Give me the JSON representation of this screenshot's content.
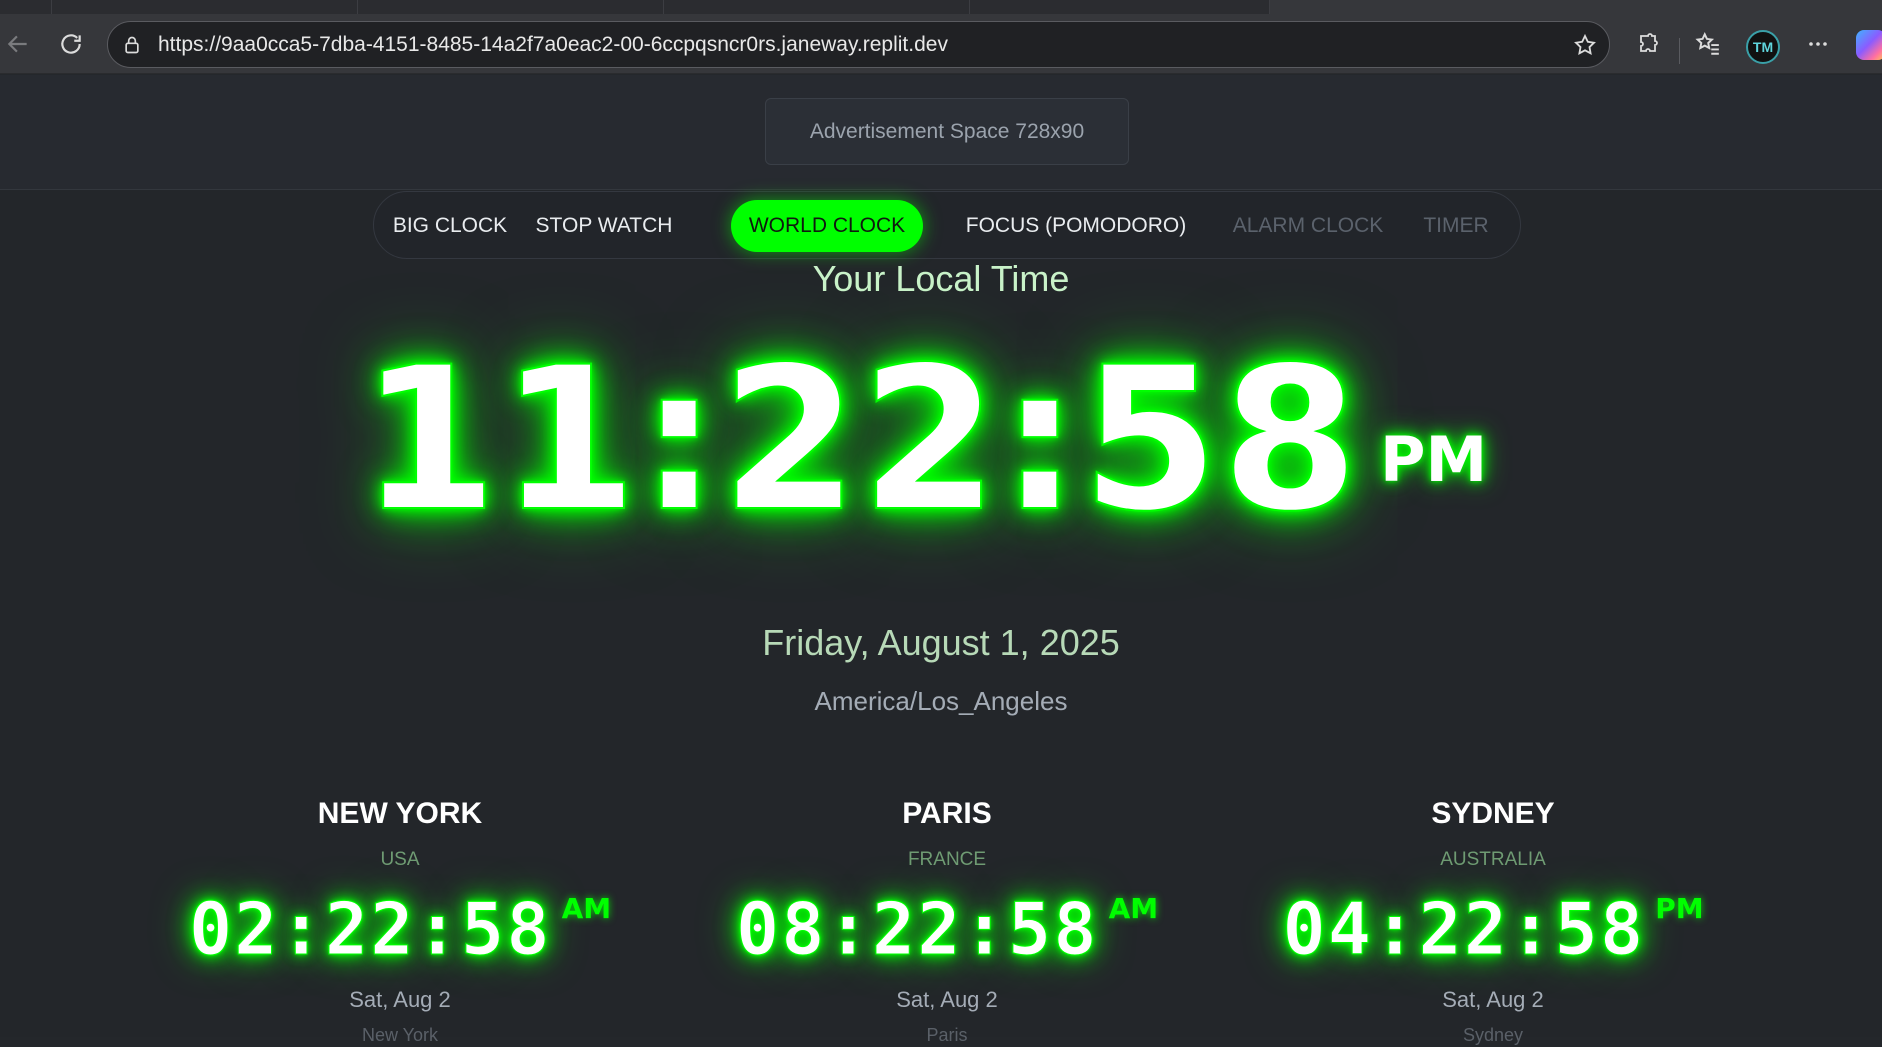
{
  "browser": {
    "url": "https://9aa0cca5-7dba-4151-8485-14a2f7a0eac2-00-6ccpqsncr0rs.janeway.replit.dev",
    "profile_initials": "TM",
    "icons": {
      "back": "back-arrow-icon",
      "reload": "reload-icon",
      "site_info": "lock-icon",
      "favorite": "star-icon",
      "extensions": "puzzle-icon",
      "favorites": "favorites-list-icon",
      "menu": "more-icon",
      "copilot": "copilot-icon"
    }
  },
  "ad": {
    "label": "Advertisement Space 728x90"
  },
  "nav": {
    "items": [
      {
        "label": "BIG CLOCK",
        "state": "normal"
      },
      {
        "label": "STOP WATCH",
        "state": "normal"
      },
      {
        "label": "WORLD CLOCK",
        "state": "active"
      },
      {
        "label": "FOCUS (POMODORO)",
        "state": "normal"
      },
      {
        "label": "ALARM CLOCK",
        "state": "dim"
      },
      {
        "label": "TIMER",
        "state": "dim"
      }
    ]
  },
  "local": {
    "title": "Your Local Time",
    "time": "11:22:58",
    "ampm": "PM",
    "date": "Friday, August 1, 2025",
    "timezone": "America/Los_Angeles"
  },
  "cities": [
    {
      "name": "NEW YORK",
      "country": "USA",
      "time": "02:22:58",
      "ampm": "AM",
      "date": "Sat, Aug 2",
      "sub": "New York"
    },
    {
      "name": "PARIS",
      "country": "FRANCE",
      "time": "08:22:58",
      "ampm": "AM",
      "date": "Sat, Aug 2",
      "sub": "Paris"
    },
    {
      "name": "SYDNEY",
      "country": "AUSTRALIA",
      "time": "04:22:58",
      "ampm": "PM",
      "date": "Sat, Aug 2",
      "sub": "Sydney"
    }
  ],
  "colors": {
    "accent": "#00ff00",
    "background": "#23262a"
  }
}
